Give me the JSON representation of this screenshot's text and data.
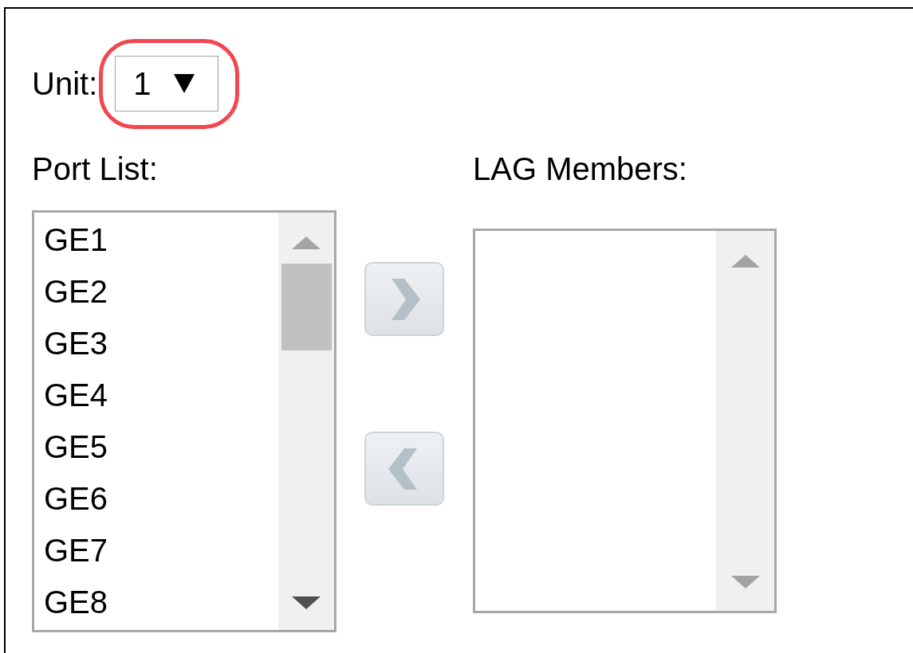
{
  "unit": {
    "label": "Unit:",
    "value": "1",
    "highlighted": true
  },
  "port_list": {
    "label": "Port List:",
    "items": [
      "GE1",
      "GE2",
      "GE3",
      "GE4",
      "GE5",
      "GE6",
      "GE7",
      "GE8"
    ]
  },
  "move_buttons": [
    {
      "kind": "add",
      "disabled": true
    },
    {
      "kind": "remove",
      "disabled": true
    }
  ],
  "lag_members": {
    "label": "LAG Members:"
  }
}
